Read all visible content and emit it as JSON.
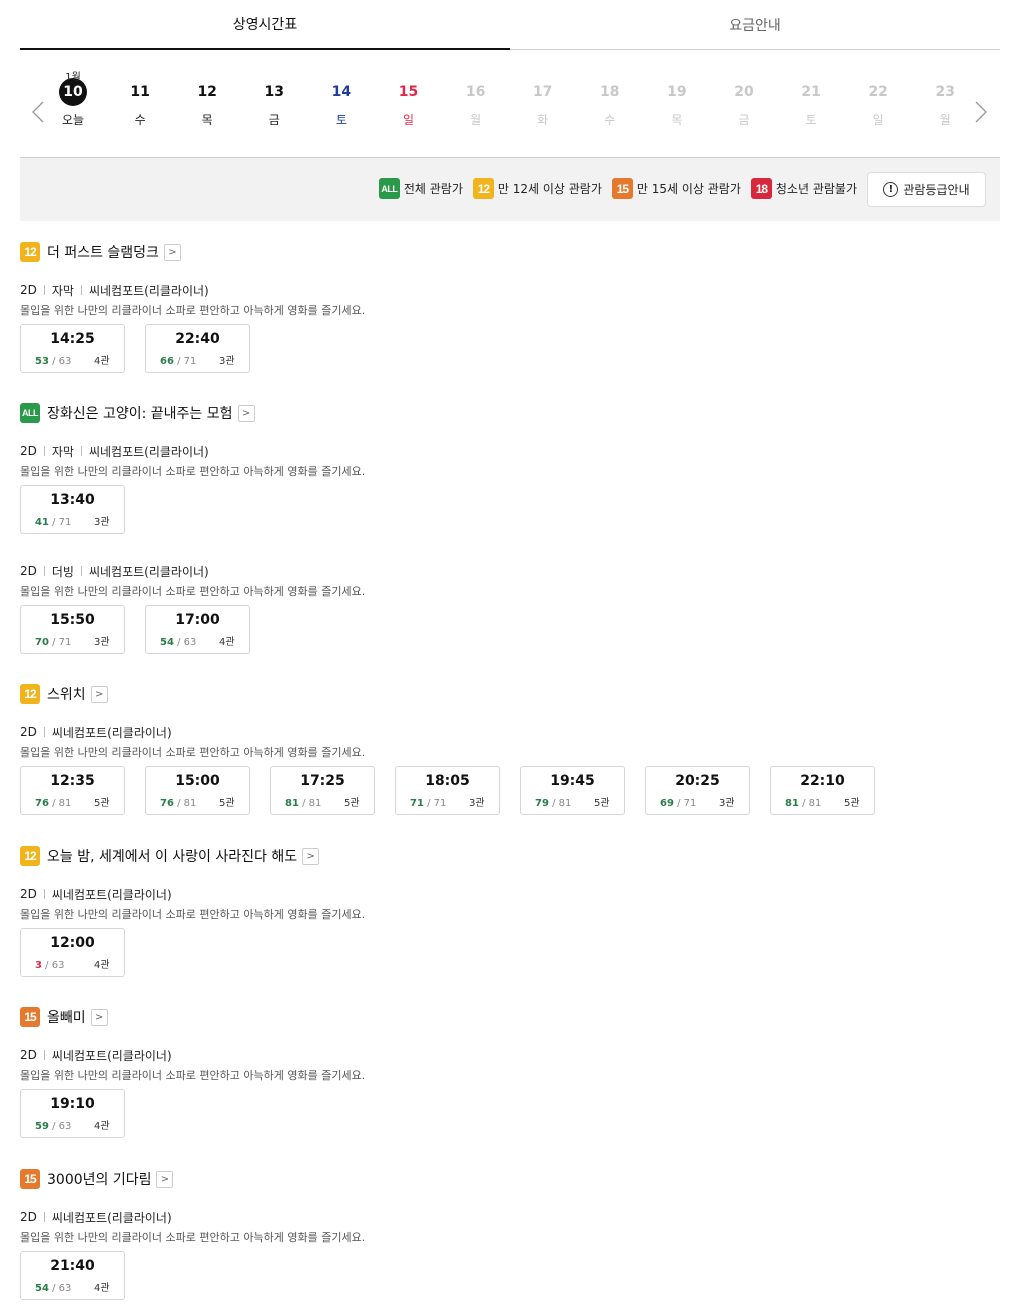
{
  "tabs": [
    "상영시간표",
    "요금안내"
  ],
  "dates": [
    {
      "month": "1월",
      "day": "10",
      "weekday": "오늘",
      "state": "selected"
    },
    {
      "month": "",
      "day": "11",
      "weekday": "수",
      "state": "normal"
    },
    {
      "month": "",
      "day": "12",
      "weekday": "목",
      "state": "normal"
    },
    {
      "month": "",
      "day": "13",
      "weekday": "금",
      "state": "normal"
    },
    {
      "month": "",
      "day": "14",
      "weekday": "토",
      "state": "sat"
    },
    {
      "month": "",
      "day": "15",
      "weekday": "일",
      "state": "sun"
    },
    {
      "month": "",
      "day": "16",
      "weekday": "월",
      "state": "disabled"
    },
    {
      "month": "",
      "day": "17",
      "weekday": "화",
      "state": "disabled"
    },
    {
      "month": "",
      "day": "18",
      "weekday": "수",
      "state": "disabled"
    },
    {
      "month": "",
      "day": "19",
      "weekday": "목",
      "state": "disabled"
    },
    {
      "month": "",
      "day": "20",
      "weekday": "금",
      "state": "disabled"
    },
    {
      "month": "",
      "day": "21",
      "weekday": "토",
      "state": "disabled"
    },
    {
      "month": "",
      "day": "22",
      "weekday": "일",
      "state": "disabled"
    },
    {
      "month": "",
      "day": "23",
      "weekday": "월",
      "state": "disabled"
    }
  ],
  "legend": {
    "items": [
      {
        "badge": "ALL",
        "cls": "all",
        "label": "전체 관람가"
      },
      {
        "badge": "12",
        "cls": "r12",
        "label": "만 12세 이상 관람가"
      },
      {
        "badge": "15",
        "cls": "r15",
        "label": "만 15세 이상 관람가"
      },
      {
        "badge": "18",
        "cls": "r18",
        "label": "청소년 관람불가"
      }
    ],
    "guide_button": "관람등급안내",
    "guide_icon": "!"
  },
  "detail_arrow": ">",
  "colors": {
    "accent": "#111111",
    "saturday": "#1f3c9c",
    "sunday": "#e0294a",
    "seats": "#2a7d4a",
    "seats_low": "#e0294a"
  },
  "movies": [
    {
      "rating": "12",
      "rating_cls": "r12",
      "title": "더 퍼스트 슬램덩크",
      "groups": [
        {
          "format": [
            "2D",
            "자막",
            "씨네컴포트(리클라이너)"
          ],
          "desc": "몰입을 위한 나만의 리클라이너 소파로 편안하고 아늑하게 영화를 즐기세요.",
          "times": [
            {
              "time": "14:25",
              "remaining": "53",
              "total": "63",
              "hall": "4관"
            },
            {
              "time": "22:40",
              "remaining": "66",
              "total": "71",
              "hall": "3관"
            }
          ]
        }
      ]
    },
    {
      "rating": "ALL",
      "rating_cls": "all",
      "title": "장화신은 고양이: 끝내주는 모험",
      "groups": [
        {
          "format": [
            "2D",
            "자막",
            "씨네컴포트(리클라이너)"
          ],
          "desc": "몰입을 위한 나만의 리클라이너 소파로 편안하고 아늑하게 영화를 즐기세요.",
          "times": [
            {
              "time": "13:40",
              "remaining": "41",
              "total": "71",
              "hall": "3관"
            }
          ]
        },
        {
          "format": [
            "2D",
            "더빙",
            "씨네컴포트(리클라이너)"
          ],
          "desc": "몰입을 위한 나만의 리클라이너 소파로 편안하고 아늑하게 영화를 즐기세요.",
          "times": [
            {
              "time": "15:50",
              "remaining": "70",
              "total": "71",
              "hall": "3관"
            },
            {
              "time": "17:00",
              "remaining": "54",
              "total": "63",
              "hall": "4관"
            }
          ]
        }
      ]
    },
    {
      "rating": "12",
      "rating_cls": "r12",
      "title": "스위치",
      "groups": [
        {
          "format": [
            "2D",
            "씨네컴포트(리클라이너)"
          ],
          "desc": "몰입을 위한 나만의 리클라이너 소파로 편안하고 아늑하게 영화를 즐기세요.",
          "times": [
            {
              "time": "12:35",
              "remaining": "76",
              "total": "81",
              "hall": "5관"
            },
            {
              "time": "15:00",
              "remaining": "76",
              "total": "81",
              "hall": "5관"
            },
            {
              "time": "17:25",
              "remaining": "81",
              "total": "81",
              "hall": "5관"
            },
            {
              "time": "18:05",
              "remaining": "71",
              "total": "71",
              "hall": "3관"
            },
            {
              "time": "19:45",
              "remaining": "79",
              "total": "81",
              "hall": "5관"
            },
            {
              "time": "20:25",
              "remaining": "69",
              "total": "71",
              "hall": "3관"
            },
            {
              "time": "22:10",
              "remaining": "81",
              "total": "81",
              "hall": "5관"
            }
          ]
        }
      ]
    },
    {
      "rating": "12",
      "rating_cls": "r12",
      "title": "오늘 밤, 세계에서 이 사랑이 사라진다 해도",
      "groups": [
        {
          "format": [
            "2D",
            "씨네컴포트(리클라이너)"
          ],
          "desc": "몰입을 위한 나만의 리클라이너 소파로 편안하고 아늑하게 영화를 즐기세요.",
          "times": [
            {
              "time": "12:00",
              "remaining": "3",
              "total": "63",
              "hall": "4관",
              "low": true
            }
          ]
        }
      ]
    },
    {
      "rating": "15",
      "rating_cls": "r15",
      "title": "올빼미",
      "groups": [
        {
          "format": [
            "2D",
            "씨네컴포트(리클라이너)"
          ],
          "desc": "몰입을 위한 나만의 리클라이너 소파로 편안하고 아늑하게 영화를 즐기세요.",
          "times": [
            {
              "time": "19:10",
              "remaining": "59",
              "total": "63",
              "hall": "4관"
            }
          ]
        }
      ]
    },
    {
      "rating": "15",
      "rating_cls": "r15",
      "title": "3000년의 기다림",
      "groups": [
        {
          "format": [
            "2D",
            "씨네컴포트(리클라이너)"
          ],
          "desc": "몰입을 위한 나만의 리클라이너 소파로 편안하고 아늑하게 영화를 즐기세요.",
          "times": [
            {
              "time": "21:40",
              "remaining": "54",
              "total": "63",
              "hall": "4관"
            }
          ]
        }
      ]
    }
  ]
}
